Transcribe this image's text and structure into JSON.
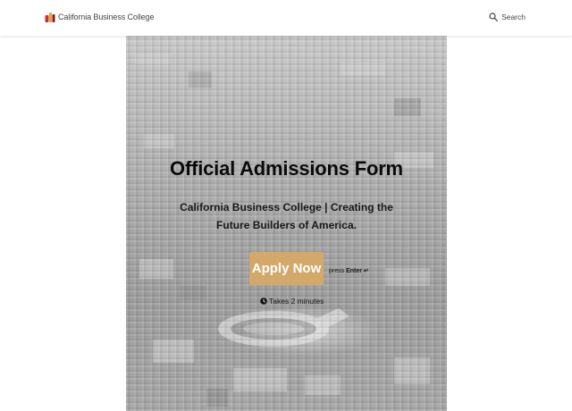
{
  "header": {
    "brand_name": "California Business College",
    "logo_icon": "college-logo-icon",
    "search_label": "Search",
    "search_icon": "search-icon"
  },
  "hero": {
    "background_image": "aerial-city-stadium-photo",
    "title": "Official Admissions Form",
    "subtitle": "California Business College | Creating the Future Builders of America.",
    "apply_button_label": "Apply Now",
    "enter_hint_prefix": "press",
    "enter_hint_key": "Enter ↵",
    "time_note": "Takes 2 minutes",
    "time_icon": "clock-icon"
  },
  "colors": {
    "accent_button": "#d2a968",
    "title_text": "#0a0a0a",
    "header_bg": "#ffffff"
  }
}
